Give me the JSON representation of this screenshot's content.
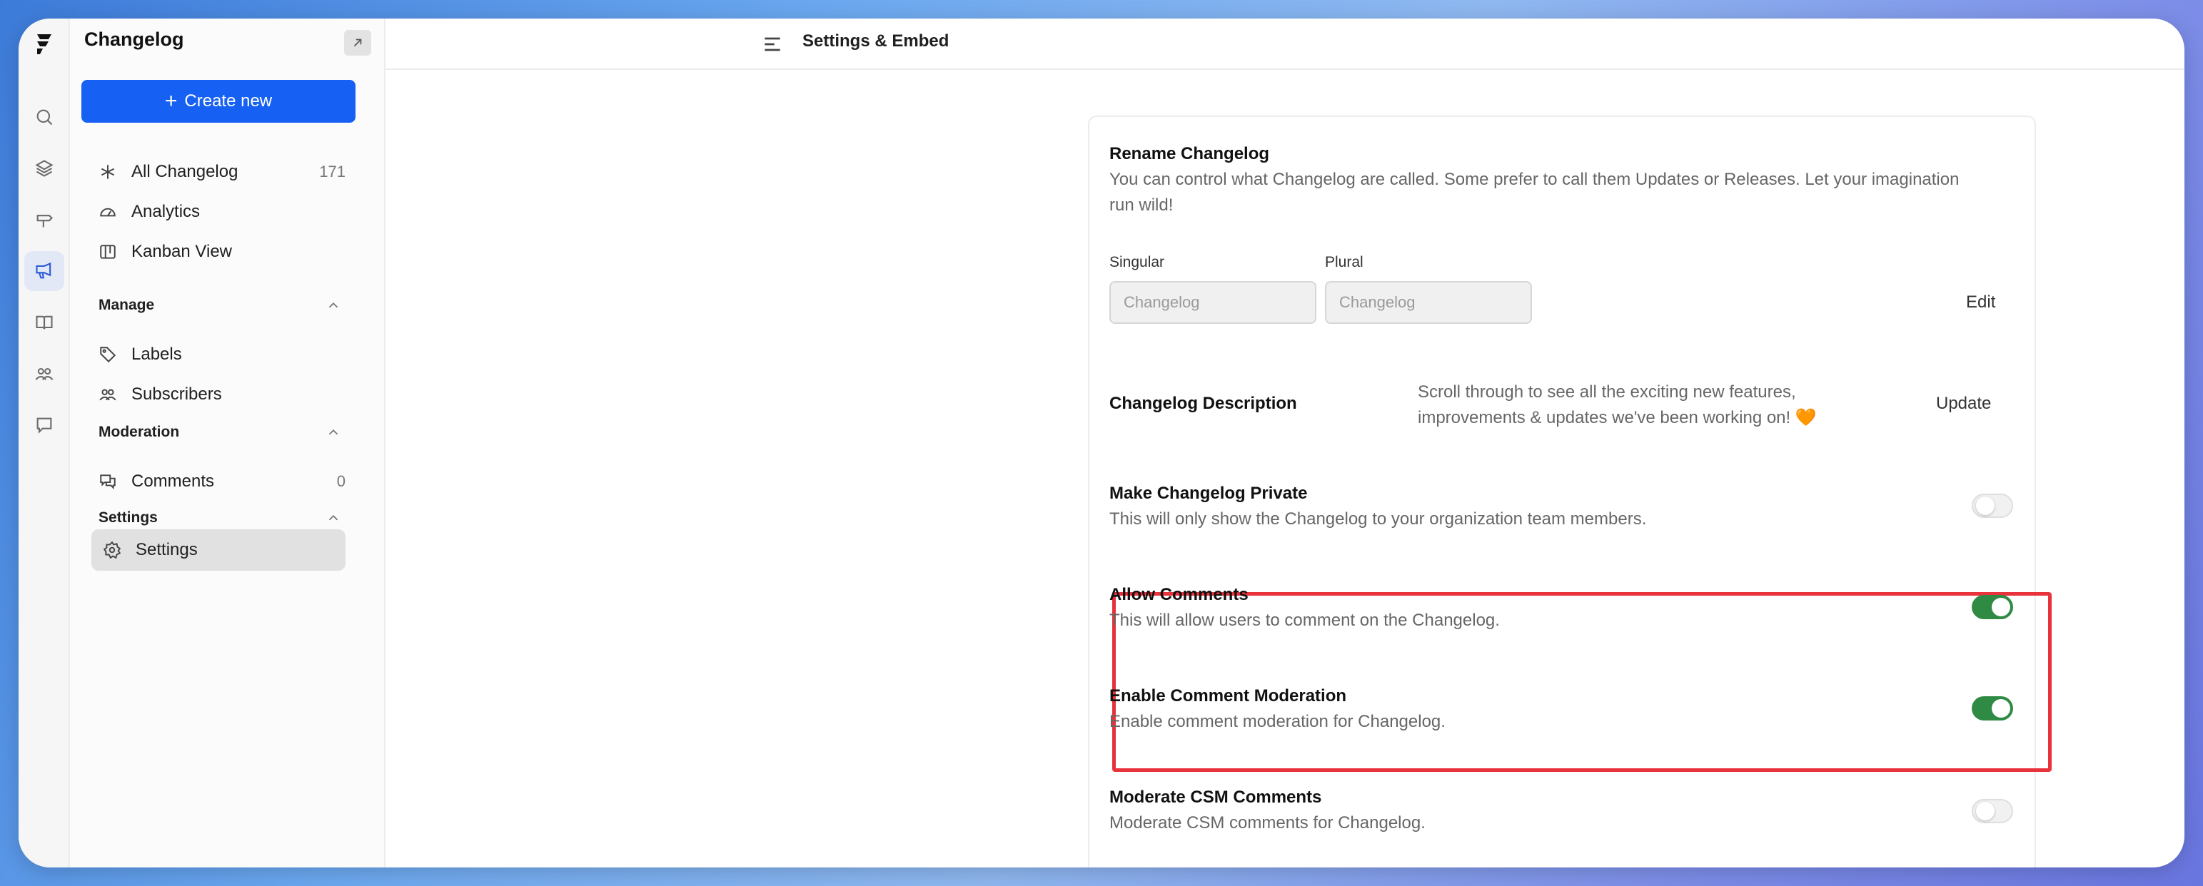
{
  "app": {
    "name": "Changelog"
  },
  "rail": {
    "icons": [
      "search-icon",
      "layers-icon",
      "signpost-icon",
      "megaphone-icon",
      "book-icon",
      "users-icon",
      "message-icon"
    ],
    "active": "megaphone-icon"
  },
  "sidebar": {
    "title": "Changelog",
    "create_label": "Create new",
    "items": [
      {
        "label": "All Changelog",
        "count": "171",
        "icon": "sparkle-icon"
      },
      {
        "label": "Analytics",
        "icon": "gauge-icon"
      },
      {
        "label": "Kanban View",
        "icon": "kanban-icon"
      }
    ],
    "sections": {
      "manage": {
        "title": "Manage",
        "items": [
          {
            "label": "Labels",
            "icon": "tag-icon"
          },
          {
            "label": "Subscribers",
            "icon": "users-icon"
          }
        ]
      },
      "moderation": {
        "title": "Moderation",
        "items": [
          {
            "label": "Comments",
            "count": "0",
            "icon": "comments-icon"
          }
        ]
      },
      "settings": {
        "title": "Settings",
        "items": [
          {
            "label": "Settings",
            "icon": "gear-icon",
            "active": true
          }
        ]
      }
    }
  },
  "header": {
    "title": "Settings & Embed"
  },
  "settings": {
    "rename": {
      "title": "Rename Changelog",
      "description_line1": "You can control what Changelog are called. Some prefer to call them Updates or Releases. Let your imagination",
      "description_line2": "run wild!",
      "singular_label": "Singular",
      "singular_value": "Changelog",
      "plural_label": "Plural",
      "plural_value": "Changelog",
      "edit_label": "Edit"
    },
    "description": {
      "title": "Changelog Description",
      "text_line1": "Scroll through to see all the exciting new features,",
      "text_line2": "improvements & updates we've been working on! 🧡",
      "update_label": "Update"
    },
    "private": {
      "title": "Make Changelog Private",
      "description": "This will only show the Changelog to your organization team members.",
      "enabled": false
    },
    "allow_comments": {
      "title": "Allow Comments",
      "description": "This will allow users to comment on the Changelog.",
      "enabled": true
    },
    "comment_moderation": {
      "title": "Enable Comment Moderation",
      "description": "Enable comment moderation for Changelog.",
      "enabled": true
    },
    "csm_moderation": {
      "title": "Moderate CSM Comments",
      "description": "Moderate CSM comments for Changelog.",
      "enabled": false
    }
  },
  "colors": {
    "accent": "#1660f4",
    "toggle_on": "#2f8a43",
    "highlight": "#e8333c"
  }
}
